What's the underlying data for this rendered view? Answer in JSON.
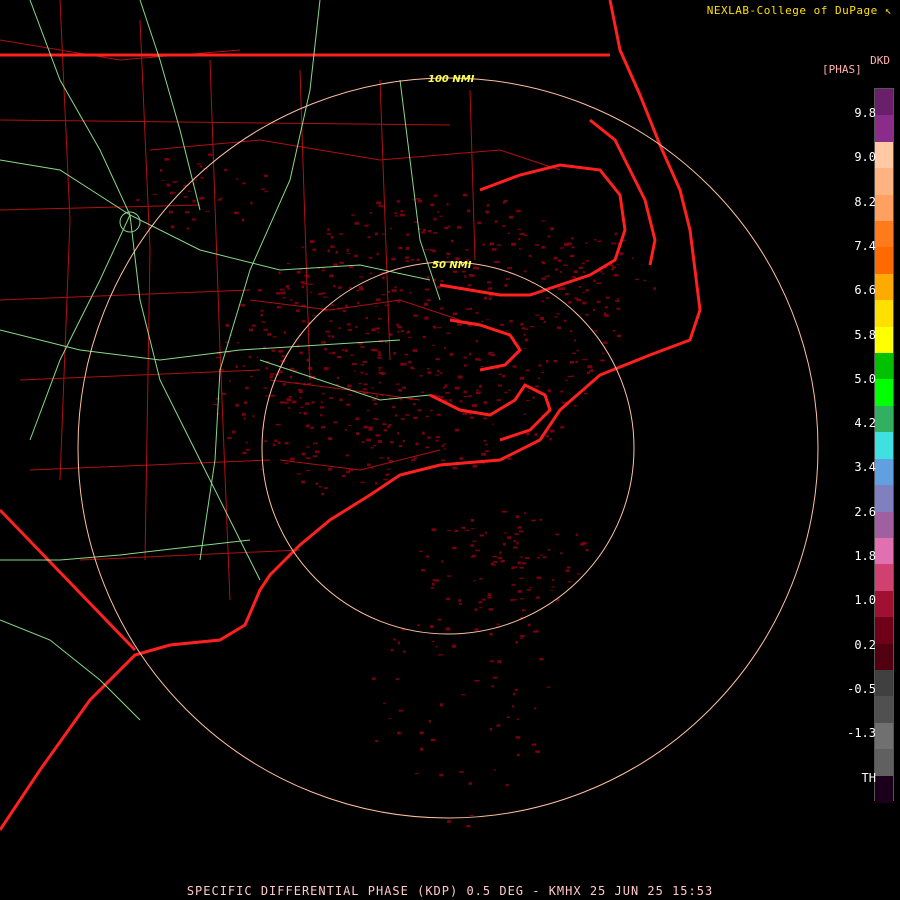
{
  "credit": "NEXLAB-College of DuPage",
  "credit_mark": "↖",
  "product": {
    "code": "DKD",
    "unit": "[PHAS]"
  },
  "rings": [
    {
      "label": "50 NMI"
    },
    {
      "label": "100 NMI"
    }
  ],
  "scale": {
    "labels": [
      "9.8",
      "9.0",
      "8.2",
      "7.4",
      "6.6",
      "5.8",
      "5.0",
      "4.2",
      "3.4",
      "2.6",
      "1.8",
      "1.0",
      "0.2",
      "-0.5",
      "-1.3",
      "TH"
    ],
    "colors": [
      "#6a1f6a",
      "#8a2c8a",
      "#ffc9a3",
      "#ffb381",
      "#ffa060",
      "#ff7a1a",
      "#ff6a00",
      "#ffaa00",
      "#ffe000",
      "#ffff00",
      "#00c000",
      "#00ff00",
      "#30b060",
      "#40e0e0",
      "#60a0e0",
      "#8080c0",
      "#a060a0",
      "#e070b0",
      "#d04070",
      "#a01030",
      "#700018",
      "#500010",
      "#404040",
      "#505050",
      "#707070",
      "#606060",
      "#1a001a"
    ]
  },
  "footer": "SPECIFIC DIFFERENTIAL PHASE (KDP) 0.5 DEG - KMHX 25 JUN 25 15:53",
  "colors": {
    "background": "#000000",
    "coast": "#ff2020",
    "county": "#b01010",
    "highway": "#a0ffa0",
    "ring": "#ffc0a0",
    "echo": "#7a0010"
  }
}
